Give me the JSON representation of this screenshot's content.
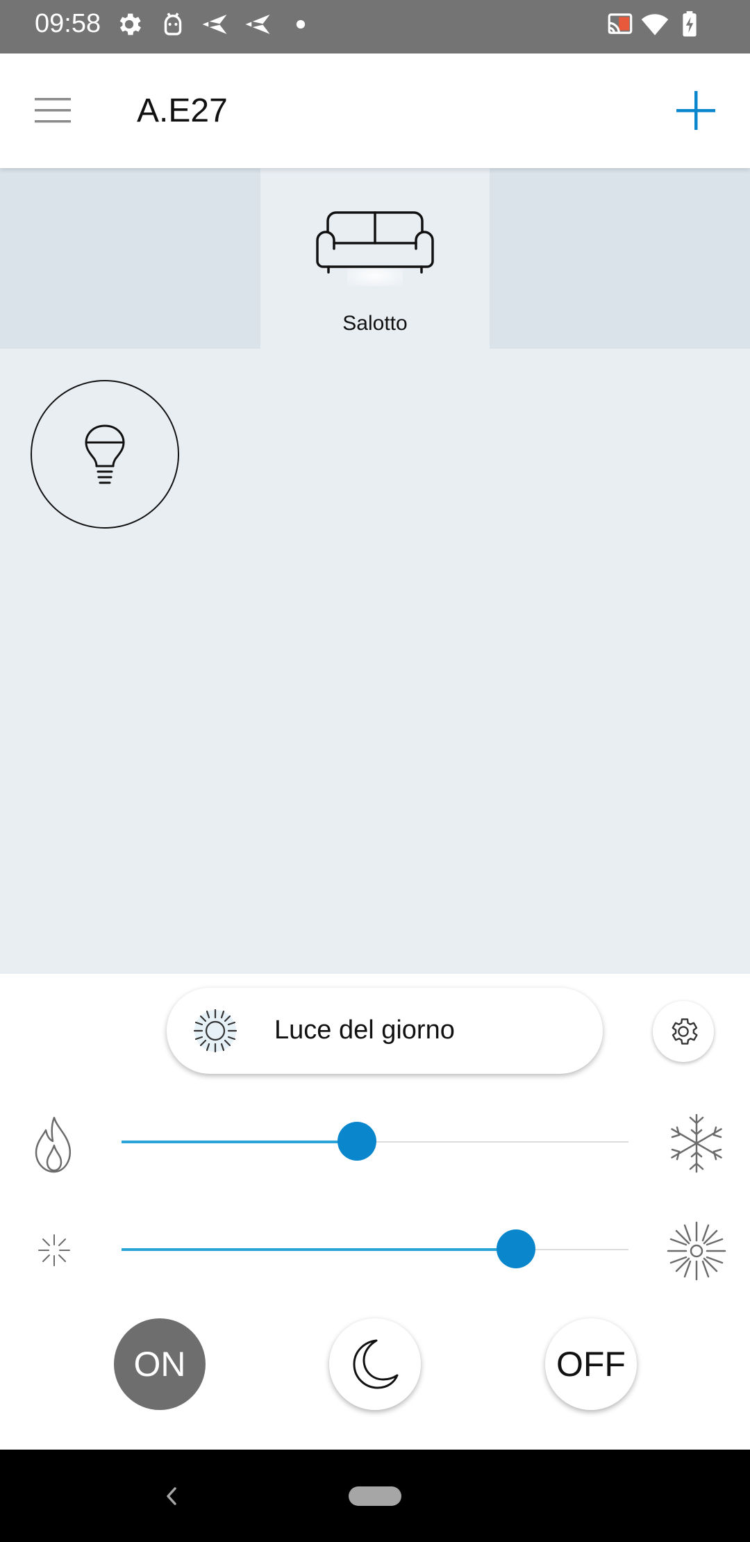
{
  "status_bar": {
    "time": "09:58",
    "left_icons": [
      "gear-icon",
      "android-icon",
      "send-icon",
      "send-icon",
      "dot-icon"
    ],
    "right_icons": [
      "cast-icon",
      "wifi-icon",
      "battery-charging-icon"
    ]
  },
  "app_bar": {
    "title": "A.E27",
    "menu_icon": "hamburger-menu-icon",
    "add_icon": "plus-icon",
    "accent_color": "#0a87cc"
  },
  "rooms": [
    {
      "label": "Salotto",
      "icon": "sofa-icon",
      "selected": true
    }
  ],
  "devices": [
    {
      "icon": "lightbulb-icon"
    }
  ],
  "controls": {
    "scene": {
      "label": "Luce del giorno",
      "icon": "sun-icon"
    },
    "settings_icon": "gear-icon",
    "temperature_slider": {
      "left_icon": "flame-icon",
      "right_icon": "snowflake-icon",
      "value_percent": 46.5
    },
    "brightness_slider": {
      "left_icon": "dim-sparkle-icon",
      "right_icon": "bright-sun-icon",
      "value_percent": 77.8
    },
    "on_label": "ON",
    "night_icon": "moon-icon",
    "off_label": "OFF",
    "slider_color": "#0a87cc"
  },
  "nav_bar": {
    "back_icon": "chevron-left-icon",
    "home_icon": "home-pill-icon"
  }
}
